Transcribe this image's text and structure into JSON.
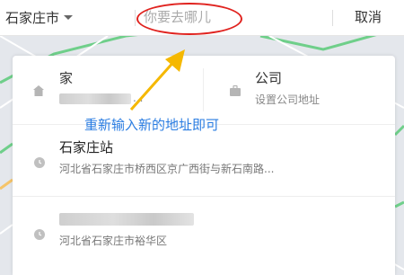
{
  "header": {
    "city": "石家庄市",
    "search_placeholder": "你要去哪儿",
    "cancel_label": "取消"
  },
  "quick": {
    "home_title": "家",
    "home_sub": "...",
    "company_title": "公司",
    "company_sub": "设置公司地址"
  },
  "history": [
    {
      "title": "石家庄站",
      "address": "河北省石家庄市桥西区京广西街与新石南路..."
    },
    {
      "title": "",
      "address": "河北省石家庄市裕华区"
    }
  ],
  "annotation": {
    "text": "重新输入新的地址即可",
    "circle_color": "#e0231f",
    "arrow_color": "#f5b800",
    "text_color": "#2b7de2"
  }
}
